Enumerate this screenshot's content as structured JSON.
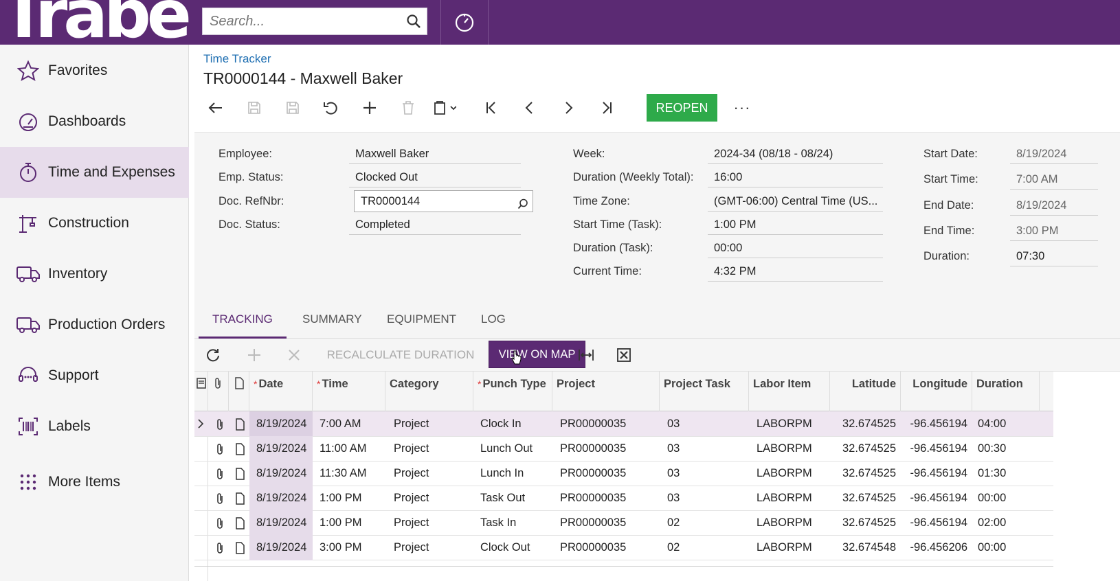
{
  "brand": {
    "logo_text": "Trabea"
  },
  "search": {
    "placeholder": "Search..."
  },
  "sidebar": {
    "items": [
      {
        "label": "Favorites",
        "icon": "star-icon"
      },
      {
        "label": "Dashboards",
        "icon": "dashboard-icon"
      },
      {
        "label": "Time and Expenses",
        "icon": "stopwatch-icon",
        "active": true
      },
      {
        "label": "Construction",
        "icon": "crane-icon"
      },
      {
        "label": "Inventory",
        "icon": "truck-icon"
      },
      {
        "label": "Production Orders",
        "icon": "truck-icon"
      },
      {
        "label": "Support",
        "icon": "headset-icon"
      },
      {
        "label": "Labels",
        "icon": "barcode-icon"
      },
      {
        "label": "More Items",
        "icon": "dots-grid-icon"
      }
    ]
  },
  "header": {
    "breadcrumb": "Time Tracker",
    "title": "TR0000144 - Maxwell Baker"
  },
  "toolbar": {
    "reopen_label": "REOPEN",
    "more_label": "···"
  },
  "form": {
    "col1": [
      {
        "label": "Employee:",
        "value": "Maxwell Baker"
      },
      {
        "label": "Emp. Status:",
        "value": "Clocked Out"
      },
      {
        "label": "Doc. RefNbr:",
        "value": "TR0000144"
      },
      {
        "label": "Doc. Status:",
        "value": "Completed"
      }
    ],
    "col2": [
      {
        "label": "Week:",
        "value": "2024-34 (08/18 - 08/24)"
      },
      {
        "label": "Duration (Weekly Total):",
        "value": "16:00"
      },
      {
        "label": "Time Zone:",
        "value": "(GMT-06:00) Central Time (US..."
      },
      {
        "label": "Start Time (Task):",
        "value": "1:00 PM"
      },
      {
        "label": "Duration (Task):",
        "value": "00:00"
      },
      {
        "label": "Current Time:",
        "value": "4:32 PM"
      }
    ],
    "col3": [
      {
        "label": "Start Date:",
        "value": "8/19/2024"
      },
      {
        "label": "Start Time:",
        "value": "7:00 AM"
      },
      {
        "label": "End Date:",
        "value": "8/19/2024"
      },
      {
        "label": "End Time:",
        "value": "3:00 PM"
      },
      {
        "label": "Duration:",
        "value": "07:30"
      }
    ]
  },
  "tabs": [
    "TRACKING",
    "SUMMARY",
    "EQUIPMENT",
    "LOG"
  ],
  "grid_toolbar": {
    "recalc_label": "RECALCULATE DURATION",
    "viewmap_label": "VIEW ON MAP"
  },
  "grid": {
    "columns": [
      "Date",
      "Time",
      "Category",
      "Punch Type",
      "Project",
      "Project Task",
      "Labor Item",
      "Latitude",
      "Longitude",
      "Duration"
    ],
    "rows": [
      [
        "8/19/2024",
        "7:00 AM",
        "Project",
        "Clock In",
        "PR00000035",
        "03",
        "LABORPM",
        "32.674525",
        "-96.456194",
        "04:00"
      ],
      [
        "8/19/2024",
        "11:00 AM",
        "Project",
        "Lunch Out",
        "PR00000035",
        "03",
        "LABORPM",
        "32.674525",
        "-96.456194",
        "00:30"
      ],
      [
        "8/19/2024",
        "11:30 AM",
        "Project",
        "Lunch In",
        "PR00000035",
        "03",
        "LABORPM",
        "32.674525",
        "-96.456194",
        "01:30"
      ],
      [
        "8/19/2024",
        "1:00 PM",
        "Project",
        "Task Out",
        "PR00000035",
        "03",
        "LABORPM",
        "32.674525",
        "-96.456194",
        "00:00"
      ],
      [
        "8/19/2024",
        "1:00 PM",
        "Project",
        "Task In",
        "PR00000035",
        "02",
        "LABORPM",
        "32.674525",
        "-96.456194",
        "02:00"
      ],
      [
        "8/19/2024",
        "3:00 PM",
        "Project",
        "Clock Out",
        "PR00000035",
        "02",
        "LABORPM",
        "32.674548",
        "-96.456206",
        "00:00"
      ]
    ]
  }
}
